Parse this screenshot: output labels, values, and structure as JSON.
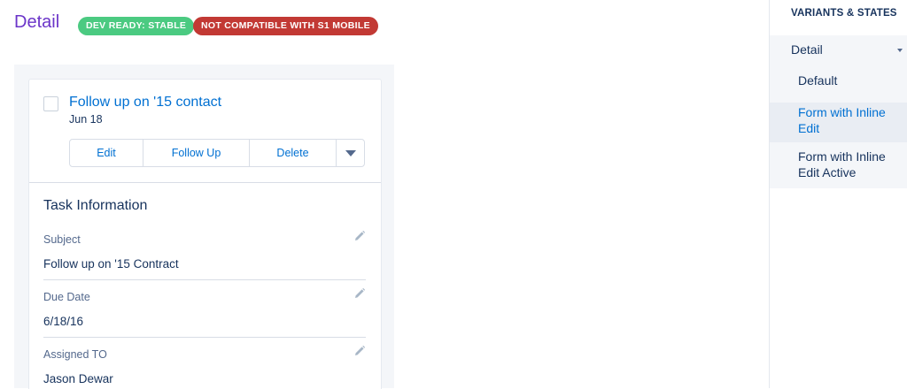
{
  "page": {
    "title": "Detail",
    "badges": [
      "DEV READY: STABLE",
      "NOT COMPATIBLE WITH S1 MOBILE"
    ]
  },
  "task": {
    "title": "Follow up on '15 contact",
    "date": "Jun 18",
    "actions": [
      "Edit",
      "Follow Up",
      "Delete"
    ]
  },
  "section": {
    "title": "Task Information",
    "fields": [
      {
        "label": "Subject",
        "value": "Follow up on '15 Contract"
      },
      {
        "label": "Due Date",
        "value": "6/18/16"
      },
      {
        "label": "Assigned TO",
        "value": "Jason Dewar"
      }
    ]
  },
  "sidebar": {
    "heading": "VARIANTS & STATES",
    "group": "Detail",
    "items": [
      "Default",
      "Form with Inline Edit",
      "Form with Inline Edit Active"
    ],
    "active_item": "Form with Inline Edit"
  },
  "icons": {
    "edit_field": "pencil-icon",
    "more_actions": "chevron-down-icon",
    "group_toggle": "caret-down-icon"
  },
  "colors": {
    "title": "#6b35c9",
    "link": "#0070d2",
    "badge_stable": "#4bca81",
    "badge_incompatible": "#c23934",
    "text": "#16325c",
    "muted": "#54698d"
  }
}
